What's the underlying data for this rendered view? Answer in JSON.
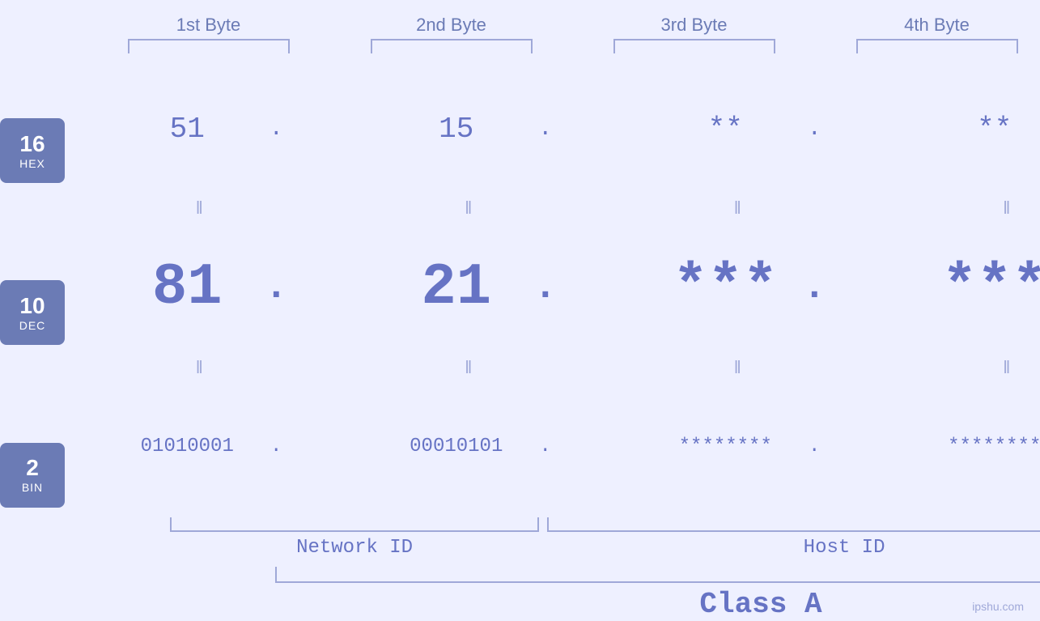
{
  "bytes": {
    "labels": [
      "1st Byte",
      "2nd Byte",
      "3rd Byte",
      "4th Byte"
    ]
  },
  "bases": [
    {
      "num": "16",
      "name": "HEX"
    },
    {
      "num": "10",
      "name": "DEC"
    },
    {
      "num": "2",
      "name": "BIN"
    }
  ],
  "rows": {
    "hex": {
      "values": [
        "51",
        "15",
        "**",
        "**"
      ],
      "separator": "‖"
    },
    "dec": {
      "values": [
        "81",
        "21",
        "***",
        "***"
      ],
      "separator": "‖"
    },
    "bin": {
      "values": [
        "01010001",
        "00010101",
        "********",
        "********"
      ],
      "separator": "‖"
    }
  },
  "labels": {
    "network_id": "Network ID",
    "host_id": "Host ID",
    "class": "Class A"
  },
  "watermark": "ipshu.com"
}
